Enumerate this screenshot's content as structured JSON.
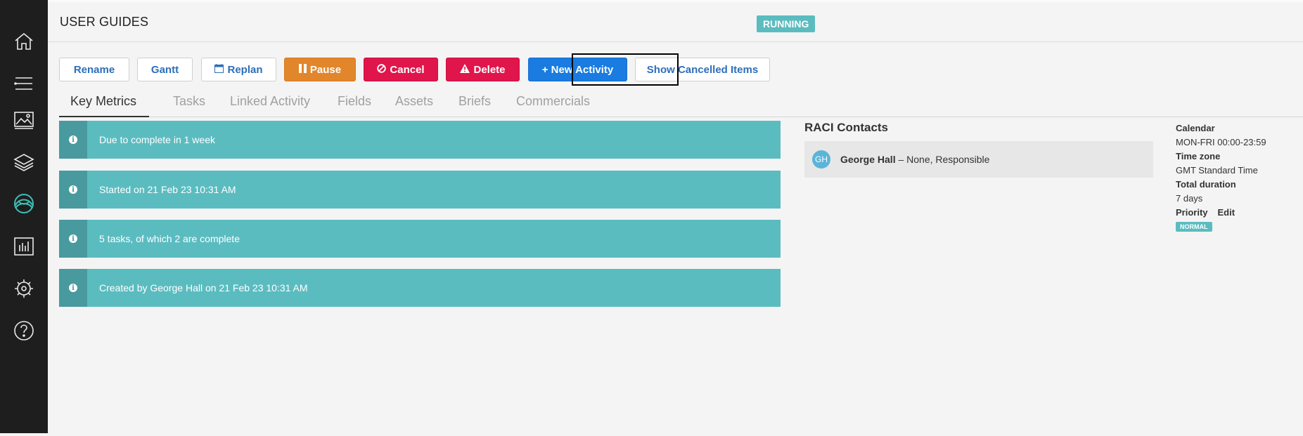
{
  "sidebar": {
    "items": [
      {
        "name": "home-icon"
      },
      {
        "name": "list-icon"
      },
      {
        "name": "image-icon"
      },
      {
        "name": "layers-icon"
      },
      {
        "name": "brand-logo-icon"
      },
      {
        "name": "bar-chart-icon"
      },
      {
        "name": "settings-icon"
      },
      {
        "name": "help-icon"
      }
    ]
  },
  "header": {
    "title": "USER GUIDES",
    "status": "RUNNING",
    "status_color": "#5bbcc0"
  },
  "toolbar": {
    "rename": "Rename",
    "gantt": "Gantt",
    "replan": "Replan",
    "pause": "Pause",
    "cancel": "Cancel",
    "delete": "Delete",
    "new_activity": "+ New Activity",
    "show_cancelled": "Show Cancelled Items"
  },
  "tabs": [
    "Key Metrics",
    "Tasks",
    "Linked Activity",
    "Fields",
    "Assets",
    "Briefs",
    "Commercials"
  ],
  "metrics": [
    "Due to complete in 1 week",
    "Started on 21 Feb 23 10:31 AM",
    "5 tasks, of which 2 are complete",
    "Created by George Hall on 21 Feb 23 10:31 AM"
  ],
  "raci": {
    "title": "RACI Contacts",
    "contact": {
      "initials": "GH",
      "name": "George Hall",
      "details": " – None, Responsible"
    }
  },
  "info": {
    "calendar_label": "Calendar",
    "calendar_value": "MON-FRI 00:00-23:59",
    "timezone_label": "Time zone",
    "timezone_value": "GMT Standard Time",
    "duration_label": "Total duration",
    "duration_value": "7 days",
    "priority_label": "Priority",
    "edit_label": "Edit",
    "priority_value": "NORMAL"
  }
}
